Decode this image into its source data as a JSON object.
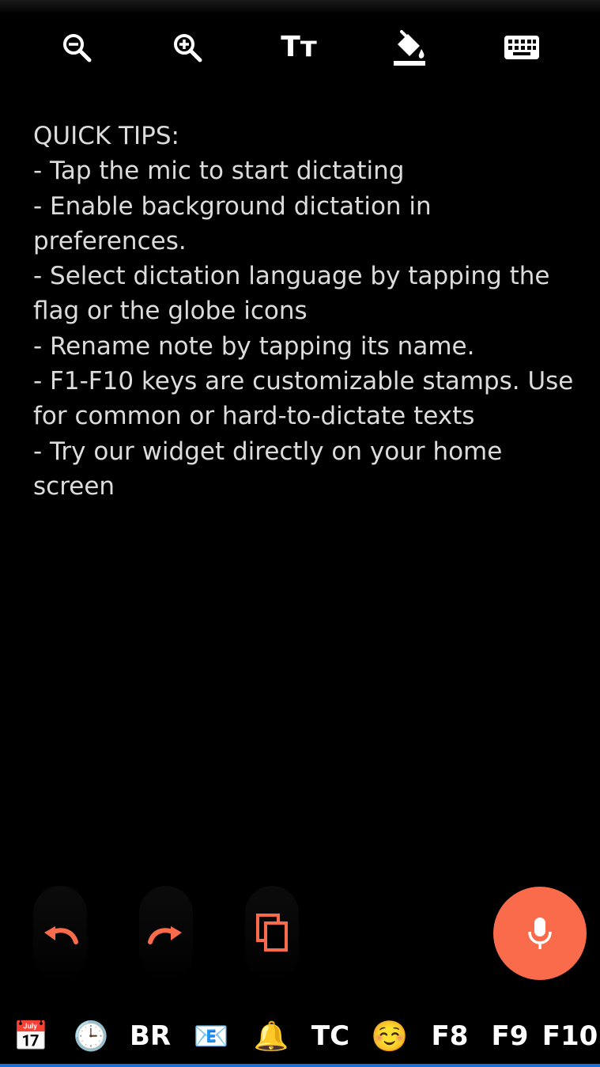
{
  "toolbar": {
    "zoom_out_icon": "zoom-out-icon",
    "zoom_in_icon": "zoom-in-icon",
    "text_size_label": "Tт",
    "fill_icon": "paint-bucket-icon",
    "keyboard_icon": "keyboard-icon"
  },
  "note": {
    "text": "QUICK TIPS:\n- Tap the mic to start dictating\n- Enable background dictation in preferences.\n- Select dictation language by tapping the flag or the globe icons\n- Rename note by tapping its name.\n- F1-F10 keys are customizable stamps. Use for common or hard-to-dictate texts\n- Try our widget directly on your home screen"
  },
  "actions": {
    "undo_icon": "undo-icon",
    "redo_icon": "redo-icon",
    "copy_icon": "copy-icon",
    "mic_icon": "microphone-icon"
  },
  "stamps": [
    {
      "key": "F1",
      "label": "📅",
      "icon": "calendar-icon"
    },
    {
      "key": "F2",
      "label": "🕒",
      "icon": "clock-icon"
    },
    {
      "key": "F3",
      "label": "BR"
    },
    {
      "key": "F4",
      "label": "📧",
      "icon": "email-icon"
    },
    {
      "key": "F5",
      "label": "🔔",
      "icon": "bell-icon"
    },
    {
      "key": "F6",
      "label": "TC"
    },
    {
      "key": "F7",
      "label": "☺️",
      "icon": "smiley-icon"
    },
    {
      "key": "F8",
      "label": "F8"
    },
    {
      "key": "F9",
      "label": "F9"
    },
    {
      "key": "F10",
      "label": "F10"
    }
  ],
  "colors": {
    "accent": "#fa6b4b",
    "background": "#000000",
    "text": "#dcdcdc",
    "bottom_line": "#1d6fd6"
  }
}
